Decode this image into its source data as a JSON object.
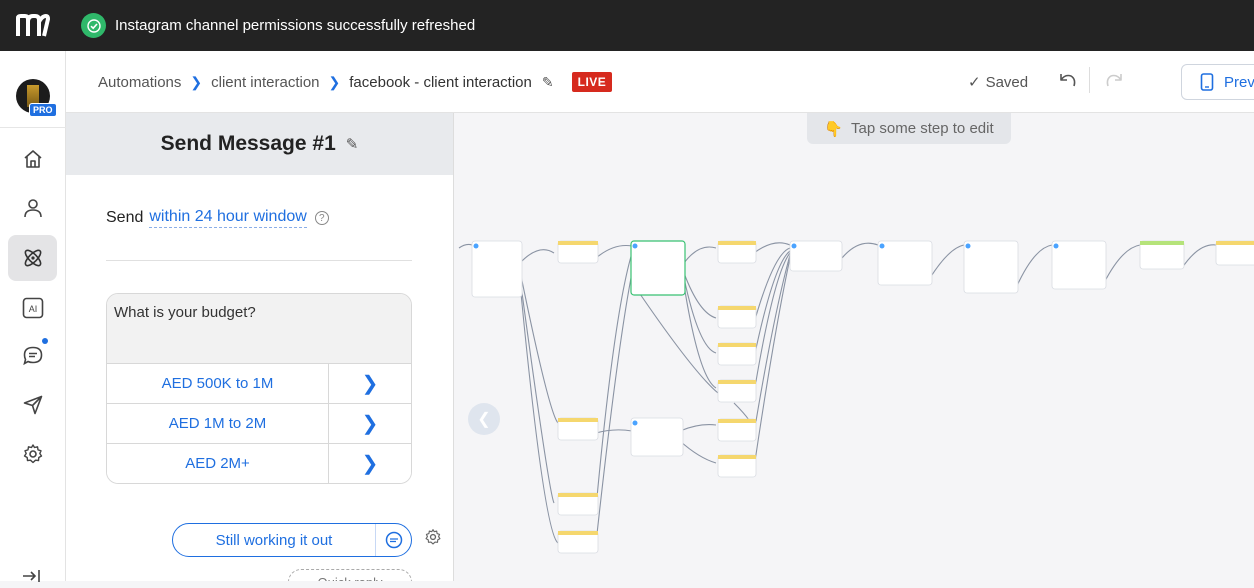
{
  "toast": {
    "message": "Instagram channel permissions successfully refreshed"
  },
  "sidebar": {
    "avatar_badge": "PRO",
    "items": [
      {
        "name": "home",
        "icon": "home-icon"
      },
      {
        "name": "contacts",
        "icon": "user-icon"
      },
      {
        "name": "automation",
        "icon": "atom-icon",
        "active": true
      },
      {
        "name": "ai",
        "icon": "ai-icon",
        "label": "AI"
      },
      {
        "name": "chat",
        "icon": "chat-icon",
        "has_dot": true
      },
      {
        "name": "broadcast",
        "icon": "send-icon"
      },
      {
        "name": "settings",
        "icon": "gear-icon"
      }
    ]
  },
  "header": {
    "breadcrumbs": [
      "Automations",
      "client interaction",
      "facebook - client interaction"
    ],
    "live_badge": "LIVE",
    "saved_label": "Saved",
    "preview_label": "Prev"
  },
  "panel": {
    "title": "Send Message #1",
    "send_prefix": "Send",
    "send_window": "within 24 hour window",
    "help_mark": "?",
    "message_text": "What is your budget?",
    "quick_replies": [
      "AED 500K to 1M",
      "AED 1M to 2M",
      "AED 2M+"
    ],
    "still_button": "Still working it out",
    "quick_reply_hint": "Quick reply"
  },
  "canvas": {
    "hint": "Tap some step to edit",
    "hint_emoji": "👇"
  },
  "colors": {
    "accent": "#1f6fe0",
    "live": "#d62a1e",
    "toast_bg": "#232323",
    "success": "#2fb86a"
  }
}
